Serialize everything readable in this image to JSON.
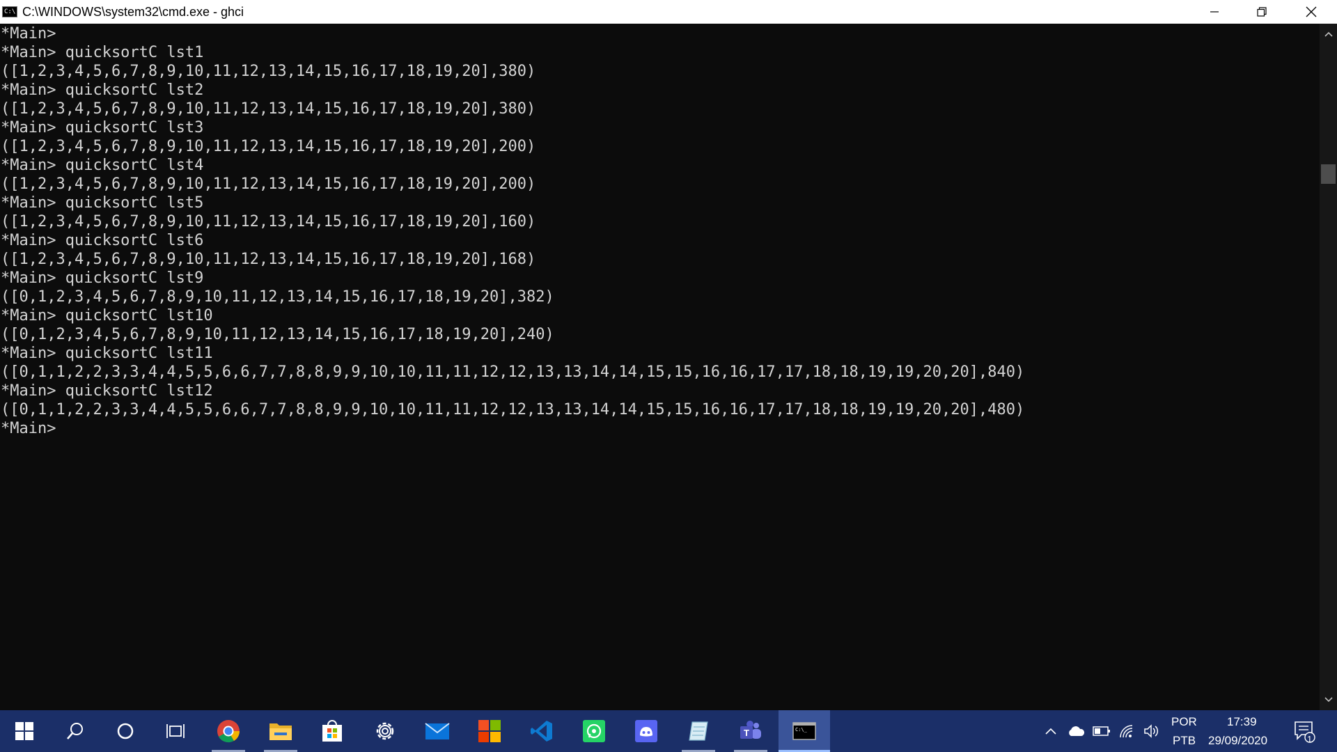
{
  "window": {
    "title": "C:\\WINDOWS\\system32\\cmd.exe - ghci"
  },
  "console": {
    "lines": [
      "*Main>",
      "*Main> quicksortC lst1",
      "([1,2,3,4,5,6,7,8,9,10,11,12,13,14,15,16,17,18,19,20],380)",
      "*Main> quicksortC lst2",
      "([1,2,3,4,5,6,7,8,9,10,11,12,13,14,15,16,17,18,19,20],380)",
      "*Main> quicksortC lst3",
      "([1,2,3,4,5,6,7,8,9,10,11,12,13,14,15,16,17,18,19,20],200)",
      "*Main> quicksortC lst4",
      "([1,2,3,4,5,6,7,8,9,10,11,12,13,14,15,16,17,18,19,20],200)",
      "*Main> quicksortC lst5",
      "([1,2,3,4,5,6,7,8,9,10,11,12,13,14,15,16,17,18,19,20],160)",
      "*Main> quicksortC lst6",
      "([1,2,3,4,5,6,7,8,9,10,11,12,13,14,15,16,17,18,19,20],168)",
      "*Main> quicksortC lst9",
      "([0,1,2,3,4,5,6,7,8,9,10,11,12,13,14,15,16,17,18,19,20],382)",
      "*Main> quicksortC lst10",
      "([0,1,2,3,4,5,6,7,8,9,10,11,12,13,14,15,16,17,18,19,20],240)",
      "*Main> quicksortC lst11",
      "([0,1,1,2,2,3,3,4,4,5,5,6,6,7,7,8,8,9,9,10,10,11,11,12,12,13,13,14,14,15,15,16,16,17,17,18,18,19,19,20,20],840)",
      "*Main> quicksortC lst12",
      "([0,1,1,2,2,3,3,4,4,5,5,6,6,7,7,8,8,9,9,10,10,11,11,12,12,13,13,14,14,15,15,16,16,17,17,18,18,19,19,20,20],480)",
      "*Main>"
    ]
  },
  "taskbar": {
    "apps": [
      {
        "name": "chrome-icon"
      },
      {
        "name": "file-explorer-icon"
      },
      {
        "name": "store-icon"
      },
      {
        "name": "settings-icon"
      },
      {
        "name": "mail-icon"
      },
      {
        "name": "office-icon"
      },
      {
        "name": "vscode-icon"
      },
      {
        "name": "whatsapp-icon"
      },
      {
        "name": "discord-icon"
      },
      {
        "name": "notepad-icon"
      },
      {
        "name": "teams-icon"
      },
      {
        "name": "cmd-icon"
      }
    ],
    "tray": {
      "lang_top": "POR",
      "lang_bottom": "PTB",
      "time": "17:39",
      "date": "29/09/2020",
      "notifications_count": "1"
    }
  },
  "colors": {
    "console_bg": "#0c0c0c",
    "console_fg": "#d4d4d4",
    "taskbar_bg": "#1b2f68",
    "titlebar_bg": "#ffffff"
  }
}
